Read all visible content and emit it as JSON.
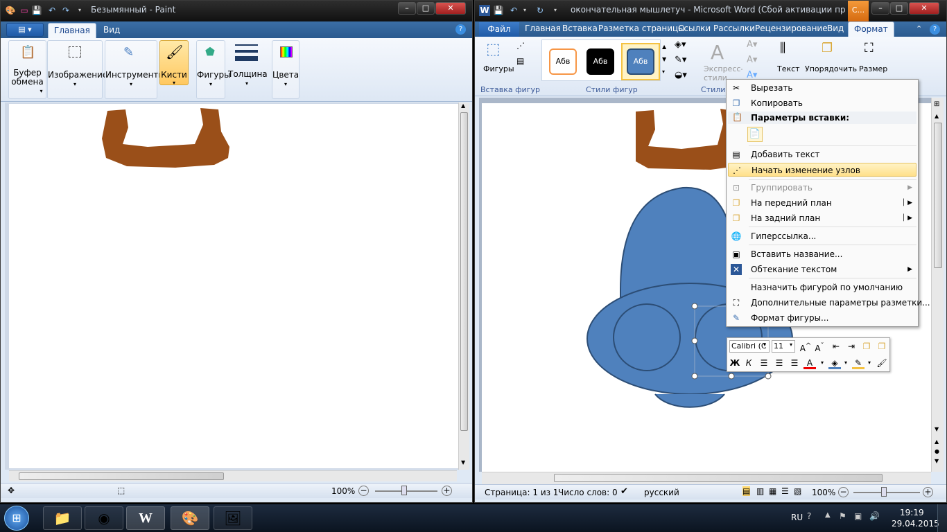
{
  "paint": {
    "title": "Безымянный - Paint",
    "tabs": {
      "home": "Главная",
      "view": "Вид"
    },
    "groups": {
      "clipboard": "Буфер обмена",
      "image": "Изображение",
      "tools": "Инструменты",
      "brushes": "Кисти",
      "shapes": "Фигуры",
      "thickness": "Толщина",
      "colors": "Цвета"
    },
    "status": {
      "zoom": "100%"
    }
  },
  "word": {
    "title": "окончательная мышлетуч - Microsoft Word (Сбой активации проду...",
    "context_tab": "С...",
    "tabs": [
      "Файл",
      "Главная",
      "Вставка",
      "Разметка страницы",
      "Ссылки",
      "Рассылки",
      "Рецензирование",
      "Вид",
      "Формат"
    ],
    "ribbon": {
      "shapes_btn": "Фигуры",
      "insert_shapes_group": "Вставка фигур",
      "style_sample": "Абв",
      "shape_styles_group": "Стили фигур",
      "express_styles": "Экспресс-стили",
      "wordart_group": "Стили W",
      "text_btn": "Текст",
      "arrange_btn": "Упорядочить",
      "size_btn": "Размер"
    },
    "status": {
      "page": "Страница: 1 из 1",
      "words": "Число слов: 0",
      "lang": "русский",
      "zoom": "100%"
    }
  },
  "context_menu": {
    "cut": "Вырезать",
    "copy": "Копировать",
    "paste_options": "Параметры вставки:",
    "add_text": "Добавить текст",
    "edit_points": "Начать изменение узлов",
    "group": "Группировать",
    "bring_front": "На передний план",
    "send_back": "На задний план",
    "hyperlink": "Гиперссылка...",
    "insert_caption": "Вставить название...",
    "text_wrap": "Обтекание текстом",
    "set_default": "Назначить фигурой по умолчанию",
    "more_layout": "Дополнительные параметры разметки...",
    "format_shape": "Формат фигуры..."
  },
  "mini_toolbar": {
    "font": "Calibri (С",
    "size": "11"
  },
  "taskbar": {
    "lang": "RU",
    "time": "19:19",
    "date": "29.04.2015"
  },
  "colors": {
    "brown_stroke": "#9a4f19",
    "shape_fill": "#4f81bd",
    "shape_border": "#2c4d75",
    "ribbon_blue": "#2b5797"
  }
}
